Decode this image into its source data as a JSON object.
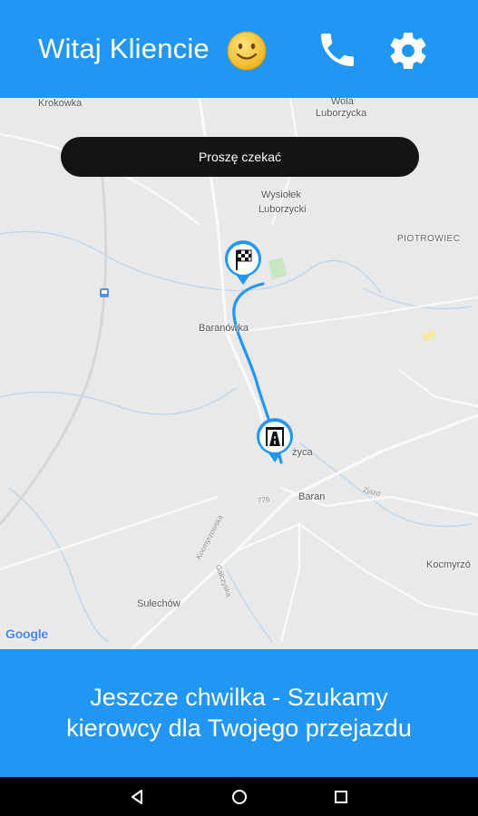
{
  "header": {
    "greeting": "Witaj Kliencie",
    "icons": [
      "smiley-emoji",
      "phone-icon",
      "settings-gear-icon"
    ],
    "background_color": "#2196f3"
  },
  "map": {
    "toast": "Proszę czekać",
    "labels": {
      "krokowka": "Krokowka",
      "wola_1": "Wola",
      "wola_2": "Luborzycka",
      "wysiolek_1": "Wysiołek",
      "wysiolek_2": "Luborzycki",
      "piotrowiec": "PIOTROWIEC",
      "baranowka": "Baranówka",
      "zyca": "życa",
      "baran": "Baran",
      "road_776": "776",
      "kocmyrzowska": "Kocmyrzowska",
      "galczyska": "Gałczyska",
      "sulechow": "Sulechów",
      "kocmyrzow": "Kocmyrzó",
      "zjazd": "Zjazd"
    },
    "markers": [
      "destination-finish-flag-marker",
      "pickup-origin-marker"
    ],
    "route_color": "#2196f3",
    "attribution": "Google"
  },
  "footer": {
    "status_line1": "Jeszcze chwilka - Szukamy",
    "status_line2": "kierowcy dla Twojego przejazdu"
  },
  "navbar": {
    "buttons": [
      "back-icon",
      "home-icon",
      "recents-icon"
    ]
  }
}
